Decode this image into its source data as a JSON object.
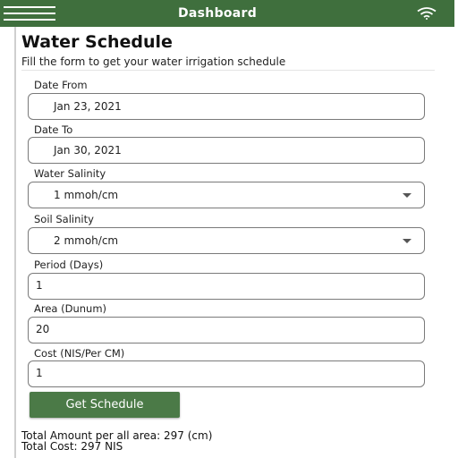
{
  "topbar": {
    "title": "Dashboard",
    "menu_icon": "hamburger-menu-icon",
    "status_icon": "wifi-icon",
    "color": "#3f6f3d"
  },
  "page": {
    "title": "Water Schedule",
    "subtitle": "Fill the form to get your water irrigation schedule"
  },
  "form": {
    "date_from": {
      "label": "Date From",
      "value": "Jan 23, 2021"
    },
    "date_to": {
      "label": "Date To",
      "value": "Jan 30, 2021"
    },
    "water_salinity": {
      "label": "Water Salinity",
      "value": "1 mmoh/cm"
    },
    "soil_salinity": {
      "label": "Soil Salinity",
      "value": "2 mmoh/cm"
    },
    "period": {
      "label": "Period (Days)",
      "value": "1"
    },
    "area": {
      "label": "Area (Dunum)",
      "value": "20"
    },
    "cost": {
      "label": "Cost (NIS/Per CM)",
      "value": "1"
    },
    "submit_label": "Get Schedule",
    "button_color": "#4b7a47"
  },
  "results": {
    "total_amount": "Total Amount per all area: 297 (cm)",
    "total_cost": "Total Cost: 297 NIS"
  }
}
